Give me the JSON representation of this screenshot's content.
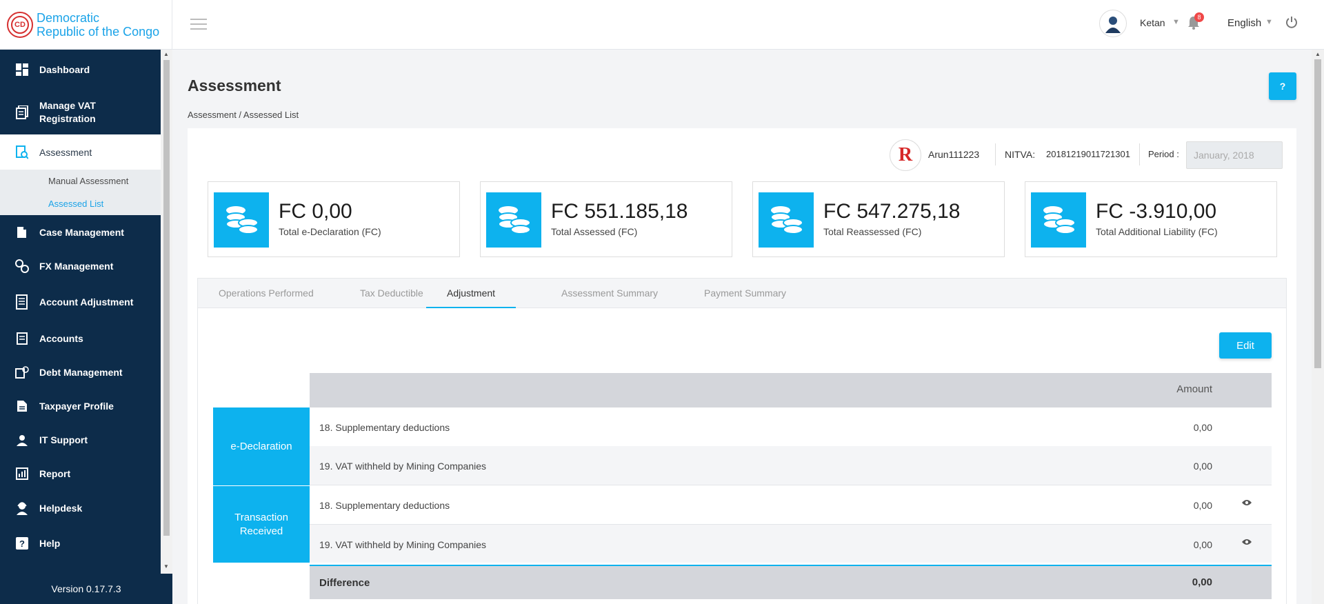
{
  "brand": {
    "line1": "Democratic",
    "line2": "Republic of the Congo",
    "logo_text": "CD"
  },
  "sidebar": {
    "items": [
      {
        "label": "Dashboard"
      },
      {
        "label": "Manage VAT"
      },
      {
        "label": "Registration"
      },
      {
        "label": "Assessment"
      },
      {
        "label": "Case Management"
      },
      {
        "label": "FX Management"
      },
      {
        "label": "Account Adjustment"
      },
      {
        "label": "Accounts"
      },
      {
        "label": "Debt Management"
      },
      {
        "label": "Taxpayer Profile"
      },
      {
        "label": "IT Support"
      },
      {
        "label": "Report"
      },
      {
        "label": "Helpdesk"
      },
      {
        "label": "Help"
      }
    ],
    "submenu": [
      {
        "label": "Manual Assessment"
      },
      {
        "label": "Assessed List"
      }
    ],
    "version": "Version 0.17.7.3"
  },
  "topbar": {
    "user": "Ketan",
    "notifications": "8",
    "language": "English"
  },
  "page": {
    "title": "Assessment",
    "breadcrumb": "Assessment / Assessed List",
    "help_label": "?"
  },
  "taxpayer": {
    "logo_text": "R",
    "name": "Arun111223",
    "nitva_label": "NITVA:",
    "nitva": "20181219011721301",
    "period_label": "Period :",
    "period": "January, 2018"
  },
  "stats": [
    {
      "value": "FC 0,00",
      "label": "Total e-Declaration (FC)"
    },
    {
      "value": "FC 551.185,18",
      "label": "Total Assessed (FC)"
    },
    {
      "value": "FC 547.275,18",
      "label": "Total Reassessed (FC)"
    },
    {
      "value": "FC -3.910,00",
      "label": "Total Additional Liability (FC)"
    }
  ],
  "tabs": [
    {
      "label": "Operations Performed"
    },
    {
      "label": "Tax Deductible"
    },
    {
      "label": "Adjustment"
    },
    {
      "label": "Assessment Summary"
    },
    {
      "label": "Payment Summary"
    }
  ],
  "edit_label": "Edit",
  "table": {
    "amount_header": "Amount",
    "groups": [
      {
        "name": "e-Declaration",
        "rows": [
          {
            "label": "18. Supplementary deductions",
            "value": "0,00"
          },
          {
            "label": "19. VAT withheld by Mining Companies",
            "value": "0,00"
          }
        ]
      },
      {
        "name_line1": "Transaction",
        "name_line2": "Received",
        "rows": [
          {
            "label": "18. Supplementary deductions",
            "value": "0,00"
          },
          {
            "label": "19. VAT withheld by Mining Companies",
            "value": "0,00"
          }
        ]
      }
    ],
    "difference_label": "Difference",
    "difference_value": "0,00"
  },
  "colors": {
    "accent": "#0db2ee",
    "sidebar": "#0d2c4a",
    "brand": "#1aa3e8",
    "badge": "#f04848"
  },
  "icons": {
    "sidebar": [
      "dashboard-icon",
      "registration-icon",
      "assessment-icon",
      "case-icon",
      "fx-icon",
      "adjustment-icon",
      "accounts-icon",
      "debt-icon",
      "profile-icon",
      "support-icon",
      "report-icon",
      "helpdesk-icon",
      "help-icon"
    ],
    "stat": "coins-icon"
  }
}
